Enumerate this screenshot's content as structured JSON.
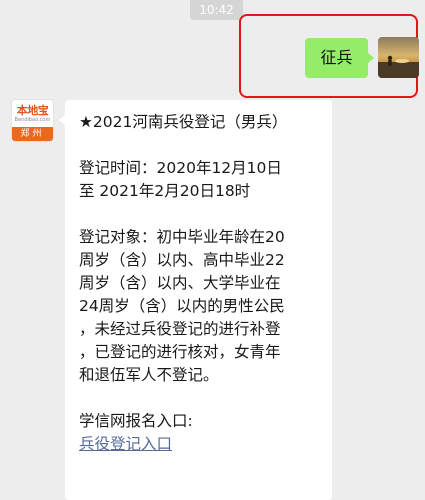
{
  "chat": {
    "timestamp": "10:42",
    "sent_message": "征兵",
    "account": {
      "logo_text": "本地宝",
      "logo_domain": "Bendibao.com",
      "city": "郑州"
    },
    "reply": {
      "title": "★2021河南兵役登记（男兵）",
      "time_text": "登记时间：2020年12月10日\n至 2021年2月20日18时",
      "target_text": "登记对象：初中毕业年龄在20\n周岁（含）以内、高中毕业22\n周岁（含）以内、大学毕业在\n24周岁（含）以内的男性公民\n，未经过兵役登记的进行补登\n，已登记的进行核对，女青年\n和退伍军人不登记。",
      "entry_label": "学信网报名入口:",
      "entry_link": "兵役登记入口"
    }
  },
  "colors": {
    "sent_bubble": "#95ec69",
    "link": "#576b95",
    "highlight_border": "#e0161b",
    "background": "#ededed"
  }
}
